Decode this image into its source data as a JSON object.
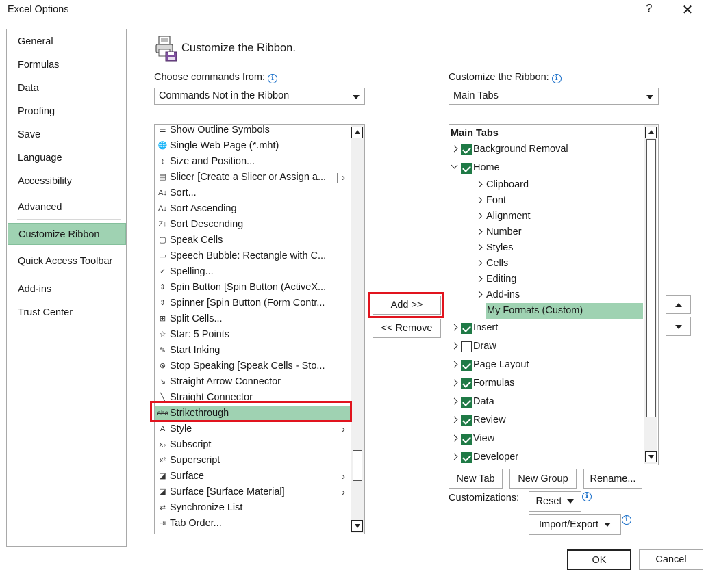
{
  "window": {
    "title": "Excel Options",
    "help_glyph": "?",
    "close_glyph": "✕"
  },
  "nav": {
    "items": [
      {
        "label": "General"
      },
      {
        "label": "Formulas"
      },
      {
        "label": "Data"
      },
      {
        "label": "Proofing"
      },
      {
        "label": "Save"
      },
      {
        "label": "Language"
      },
      {
        "label": "Accessibility"
      },
      {
        "label": "Advanced"
      },
      {
        "label": "Customize Ribbon",
        "selected": true
      },
      {
        "label": "Quick Access Toolbar"
      },
      {
        "label": "Add-ins"
      },
      {
        "label": "Trust Center"
      }
    ]
  },
  "header": {
    "title": "Customize the Ribbon.",
    "icon": "ribbon-customize-icon"
  },
  "left_panel": {
    "label": "Choose commands from:",
    "select_value": "Commands Not in the Ribbon",
    "commands": [
      {
        "label": "Show Outline Symbols",
        "icon": "outline-symbols-icon",
        "glyph": "☰"
      },
      {
        "label": "Single Web Page (*.mht)",
        "icon": "web-page-icon",
        "glyph": "🌐"
      },
      {
        "label": "Size and Position...",
        "icon": "size-position-icon",
        "glyph": "↕"
      },
      {
        "label": "Slicer [Create a Slicer or Assign a...",
        "icon": "slicer-icon",
        "glyph": "▤",
        "sub": "|  ›"
      },
      {
        "label": "Sort...",
        "icon": "sort-icon",
        "glyph": "A↓"
      },
      {
        "label": "Sort Ascending",
        "icon": "sort-ascending-icon",
        "glyph": "A↓"
      },
      {
        "label": "Sort Descending",
        "icon": "sort-descending-icon",
        "glyph": "Z↓"
      },
      {
        "label": "Speak Cells",
        "icon": "speak-cells-icon",
        "glyph": "▢"
      },
      {
        "label": "Speech Bubble: Rectangle with C...",
        "icon": "speech-bubble-icon",
        "glyph": "▭"
      },
      {
        "label": "Spelling...",
        "icon": "spelling-icon",
        "glyph": "✓"
      },
      {
        "label": "Spin Button [Spin Button (ActiveX...",
        "icon": "spin-button-icon",
        "glyph": "⇕"
      },
      {
        "label": "Spinner [Spin Button (Form Contr...",
        "icon": "spinner-icon",
        "glyph": "⇕"
      },
      {
        "label": "Split Cells...",
        "icon": "split-cells-icon",
        "glyph": "⊞"
      },
      {
        "label": "Star: 5 Points",
        "icon": "star-icon",
        "glyph": "☆"
      },
      {
        "label": "Start Inking",
        "icon": "inking-icon",
        "glyph": "✎"
      },
      {
        "label": "Stop Speaking [Speak Cells - Sto...",
        "icon": "stop-speaking-icon",
        "glyph": "⊗"
      },
      {
        "label": "Straight Arrow Connector",
        "icon": "arrow-connector-icon",
        "glyph": "↘"
      },
      {
        "label": "Straight Connector",
        "icon": "straight-connector-icon",
        "glyph": "╲"
      },
      {
        "label": "Strikethrough",
        "icon": "strikethrough-icon",
        "glyph": "abc",
        "selected": true
      },
      {
        "label": "Style",
        "icon": "style-icon",
        "glyph": "A",
        "sub": "›"
      },
      {
        "label": "Subscript",
        "icon": "subscript-icon",
        "glyph": "x₂"
      },
      {
        "label": "Superscript",
        "icon": "superscript-icon",
        "glyph": "x²"
      },
      {
        "label": "Surface",
        "icon": "surface-icon",
        "glyph": "◪",
        "sub": "›"
      },
      {
        "label": "Surface [Surface Material]",
        "icon": "surface-material-icon",
        "glyph": "◪",
        "sub": "›"
      },
      {
        "label": "Synchronize List",
        "icon": "synchronize-list-icon",
        "glyph": "⇄"
      },
      {
        "label": "Tab Order...",
        "icon": "tab-order-icon",
        "glyph": "⇥"
      }
    ]
  },
  "middle": {
    "add_label": "Add >>",
    "remove_label": "<< Remove"
  },
  "right_panel": {
    "label": "Customize the Ribbon:",
    "select_value": "Main Tabs",
    "tree_header": "Main Tabs",
    "tree": [
      {
        "label": "Background Removal",
        "level": 0,
        "expand": "right",
        "checkbox": true,
        "checked": true
      },
      {
        "label": "Home",
        "level": 0,
        "expand": "down",
        "checkbox": true,
        "checked": true
      },
      {
        "label": "Clipboard",
        "level": 1,
        "expand": "right"
      },
      {
        "label": "Font",
        "level": 1,
        "expand": "right"
      },
      {
        "label": "Alignment",
        "level": 1,
        "expand": "right"
      },
      {
        "label": "Number",
        "level": 1,
        "expand": "right"
      },
      {
        "label": "Styles",
        "level": 1,
        "expand": "right"
      },
      {
        "label": "Cells",
        "level": 1,
        "expand": "right"
      },
      {
        "label": "Editing",
        "level": 1,
        "expand": "right"
      },
      {
        "label": "Add-ins",
        "level": 1,
        "expand": "right"
      },
      {
        "label": "My Formats (Custom)",
        "level": 1,
        "expand": "none",
        "selected": true
      },
      {
        "label": "Insert",
        "level": 0,
        "expand": "right",
        "checkbox": true,
        "checked": true
      },
      {
        "label": "Draw",
        "level": 0,
        "expand": "right",
        "checkbox": true,
        "checked": false
      },
      {
        "label": "Page Layout",
        "level": 0,
        "expand": "right",
        "checkbox": true,
        "checked": true
      },
      {
        "label": "Formulas",
        "level": 0,
        "expand": "right",
        "checkbox": true,
        "checked": true
      },
      {
        "label": "Data",
        "level": 0,
        "expand": "right",
        "checkbox": true,
        "checked": true
      },
      {
        "label": "Review",
        "level": 0,
        "expand": "right",
        "checkbox": true,
        "checked": true
      },
      {
        "label": "View",
        "level": 0,
        "expand": "right",
        "checkbox": true,
        "checked": true
      },
      {
        "label": "Developer",
        "level": 0,
        "expand": "right",
        "checkbox": true,
        "checked": true
      }
    ],
    "new_tab_label": "New Tab",
    "new_group_label": "New Group",
    "rename_label": "Rename...",
    "customizations_label": "Customizations:",
    "reset_label": "Reset",
    "import_export_label": "Import/Export"
  },
  "footer": {
    "ok_label": "OK",
    "cancel_label": "Cancel"
  },
  "colors": {
    "selection": "#9fd2b2",
    "highlight_box": "#e1141e",
    "checkbox": "#1f7a46",
    "info": "#1a6fc9"
  }
}
